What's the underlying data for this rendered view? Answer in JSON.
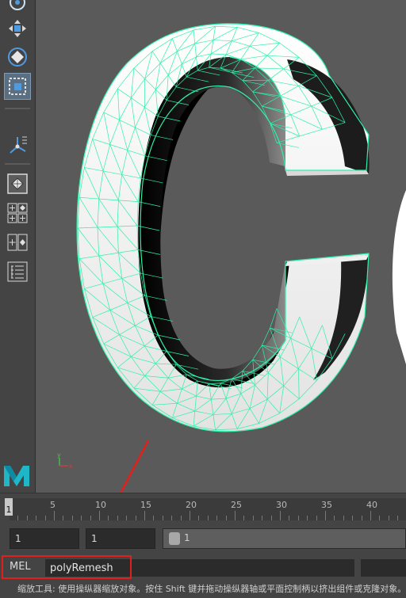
{
  "toolbox": {
    "tools": [
      {
        "name": "rotate-tool-icon"
      },
      {
        "name": "move-tool-icon"
      },
      {
        "name": "scale-diamond-tool-icon"
      },
      {
        "name": "scale-tool-icon",
        "active": true
      },
      {
        "name": "soft-select-icon"
      },
      {
        "name": "single-perspective-layout-icon"
      },
      {
        "name": "four-view-layout-icon"
      },
      {
        "name": "two-view-layout-icon"
      },
      {
        "name": "outliner-layout-icon"
      }
    ],
    "logo": "M"
  },
  "viewport": {
    "axis_x": "x",
    "axis_y": "y",
    "mesh_color": "#2ff0a8"
  },
  "timeline": {
    "ticks": [
      "5",
      "10",
      "15",
      "20",
      "25",
      "30",
      "35",
      "40"
    ],
    "current_frame": "1"
  },
  "range": {
    "start_field": "1",
    "playback_start_field": "1",
    "slider_label": "1"
  },
  "command_line": {
    "language_label": "MEL",
    "input_value": "polyRemesh"
  },
  "help_line": "缩放工具: 使用操纵器缩放对象。按住 Shift 键并拖动操纵器轴或平面控制柄以挤出组件或克隆对象。",
  "annotation_color": "#e0201d"
}
